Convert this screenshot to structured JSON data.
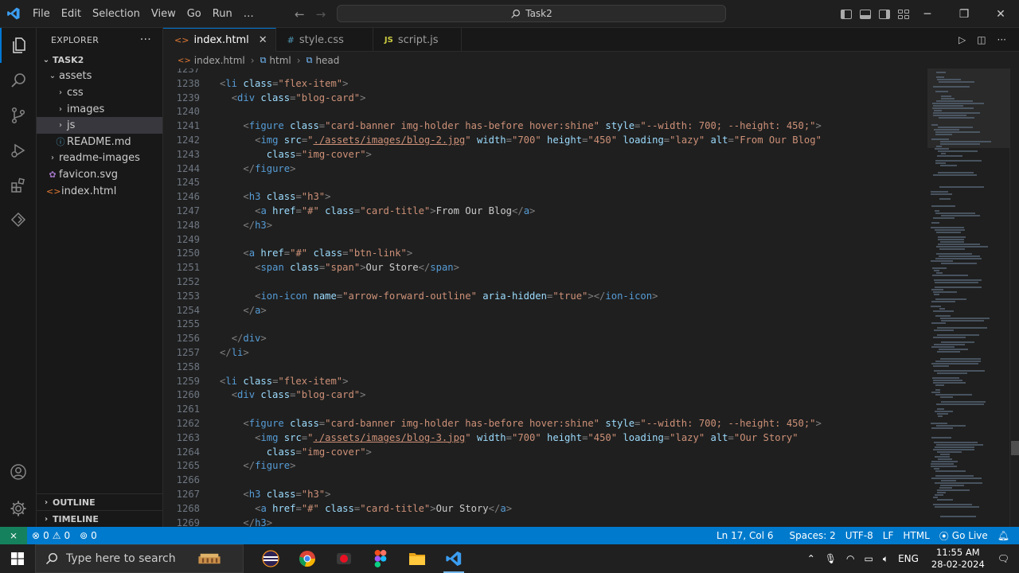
{
  "titlebar": {
    "menu": [
      "File",
      "Edit",
      "Selection",
      "View",
      "Go",
      "Run",
      "…"
    ],
    "search_text": "Task2"
  },
  "tabs": [
    {
      "label": "index.html",
      "type": "html",
      "active": true
    },
    {
      "label": "style.css",
      "type": "css",
      "active": false
    },
    {
      "label": "script.js",
      "type": "js",
      "active": false
    }
  ],
  "sidebar": {
    "title": "EXPLORER",
    "more": "···",
    "root": "TASK2",
    "items": [
      {
        "label": "assets",
        "depth": 1,
        "kind": "folder-open"
      },
      {
        "label": "css",
        "depth": 2,
        "kind": "folder"
      },
      {
        "label": "images",
        "depth": 2,
        "kind": "folder"
      },
      {
        "label": "js",
        "depth": 2,
        "kind": "folder"
      },
      {
        "label": "README.md",
        "depth": 1,
        "kind": "md"
      },
      {
        "label": "readme-images",
        "depth": 1,
        "kind": "folder"
      },
      {
        "label": "favicon.svg",
        "depth": 0,
        "kind": "svg"
      },
      {
        "label": "index.html",
        "depth": 0,
        "kind": "html"
      }
    ],
    "outline": "OUTLINE",
    "timeline": "TIMELINE"
  },
  "breadcrumb": [
    "index.html",
    "html",
    "head"
  ],
  "code": [
    {
      "n": "1237",
      "i": 12,
      "t": []
    },
    {
      "n": "1238",
      "i": 12,
      "t": [
        [
          "b",
          "<"
        ],
        [
          "g",
          "li"
        ],
        [
          "a",
          " class"
        ],
        [
          "b",
          "="
        ],
        [
          "s",
          "\"flex-item\""
        ],
        [
          "b",
          ">"
        ]
      ]
    },
    {
      "n": "1239",
      "i": 14,
      "t": [
        [
          "b",
          "<"
        ],
        [
          "g",
          "div"
        ],
        [
          "a",
          " class"
        ],
        [
          "b",
          "="
        ],
        [
          "s",
          "\"blog-card\""
        ],
        [
          "b",
          ">"
        ]
      ]
    },
    {
      "n": "1240",
      "i": 0,
      "t": []
    },
    {
      "n": "1241",
      "i": 16,
      "t": [
        [
          "b",
          "<"
        ],
        [
          "g",
          "figure"
        ],
        [
          "a",
          " class"
        ],
        [
          "b",
          "="
        ],
        [
          "s",
          "\"card-banner img-holder has-before hover:shine\""
        ],
        [
          "a",
          " style"
        ],
        [
          "b",
          "="
        ],
        [
          "s",
          "\"--width: 700; --height: 450;\""
        ],
        [
          "b",
          ">"
        ]
      ]
    },
    {
      "n": "1242",
      "i": 18,
      "t": [
        [
          "b",
          "<"
        ],
        [
          "g",
          "img"
        ],
        [
          "a",
          " src"
        ],
        [
          "b",
          "="
        ],
        [
          "s",
          "\""
        ],
        [
          "u",
          "./assets/images/blog-2.jpg"
        ],
        [
          "s",
          "\""
        ],
        [
          "a",
          " width"
        ],
        [
          "b",
          "="
        ],
        [
          "s",
          "\"700\""
        ],
        [
          "a",
          " height"
        ],
        [
          "b",
          "="
        ],
        [
          "s",
          "\"450\""
        ],
        [
          "a",
          " loading"
        ],
        [
          "b",
          "="
        ],
        [
          "s",
          "\"lazy\""
        ],
        [
          "a",
          " alt"
        ],
        [
          "b",
          "="
        ],
        [
          "s",
          "\"From Our Blog\""
        ]
      ]
    },
    {
      "n": "1243",
      "i": 20,
      "t": [
        [
          "a",
          "class"
        ],
        [
          "b",
          "="
        ],
        [
          "s",
          "\"img-cover\""
        ],
        [
          "b",
          ">"
        ]
      ]
    },
    {
      "n": "1244",
      "i": 16,
      "t": [
        [
          "b",
          "</"
        ],
        [
          "g",
          "figure"
        ],
        [
          "b",
          ">"
        ]
      ]
    },
    {
      "n": "1245",
      "i": 0,
      "t": []
    },
    {
      "n": "1246",
      "i": 16,
      "t": [
        [
          "b",
          "<"
        ],
        [
          "g",
          "h3"
        ],
        [
          "a",
          " class"
        ],
        [
          "b",
          "="
        ],
        [
          "s",
          "\"h3\""
        ],
        [
          "b",
          ">"
        ]
      ]
    },
    {
      "n": "1247",
      "i": 18,
      "t": [
        [
          "b",
          "<"
        ],
        [
          "g",
          "a"
        ],
        [
          "a",
          " href"
        ],
        [
          "b",
          "="
        ],
        [
          "s",
          "\"#\""
        ],
        [
          "a",
          " class"
        ],
        [
          "b",
          "="
        ],
        [
          "s",
          "\"card-title\""
        ],
        [
          "b",
          ">"
        ],
        [
          "x",
          "From Our Blog"
        ],
        [
          "b",
          "</"
        ],
        [
          "g",
          "a"
        ],
        [
          "b",
          ">"
        ]
      ]
    },
    {
      "n": "1248",
      "i": 16,
      "t": [
        [
          "b",
          "</"
        ],
        [
          "g",
          "h3"
        ],
        [
          "b",
          ">"
        ]
      ]
    },
    {
      "n": "1249",
      "i": 0,
      "t": []
    },
    {
      "n": "1250",
      "i": 16,
      "t": [
        [
          "b",
          "<"
        ],
        [
          "g",
          "a"
        ],
        [
          "a",
          " href"
        ],
        [
          "b",
          "="
        ],
        [
          "s",
          "\"#\""
        ],
        [
          "a",
          " class"
        ],
        [
          "b",
          "="
        ],
        [
          "s",
          "\"btn-link\""
        ],
        [
          "b",
          ">"
        ]
      ]
    },
    {
      "n": "1251",
      "i": 18,
      "t": [
        [
          "b",
          "<"
        ],
        [
          "g",
          "span"
        ],
        [
          "a",
          " class"
        ],
        [
          "b",
          "="
        ],
        [
          "s",
          "\"span\""
        ],
        [
          "b",
          ">"
        ],
        [
          "x",
          "Our Store"
        ],
        [
          "b",
          "</"
        ],
        [
          "g",
          "span"
        ],
        [
          "b",
          ">"
        ]
      ]
    },
    {
      "n": "1252",
      "i": 0,
      "t": []
    },
    {
      "n": "1253",
      "i": 18,
      "t": [
        [
          "b",
          "<"
        ],
        [
          "g",
          "ion-icon"
        ],
        [
          "a",
          " name"
        ],
        [
          "b",
          "="
        ],
        [
          "s",
          "\"arrow-forward-outline\""
        ],
        [
          "a",
          " aria-hidden"
        ],
        [
          "b",
          "="
        ],
        [
          "s",
          "\"true\""
        ],
        [
          "b",
          "></"
        ],
        [
          "g",
          "ion-icon"
        ],
        [
          "b",
          ">"
        ]
      ]
    },
    {
      "n": "1254",
      "i": 16,
      "t": [
        [
          "b",
          "</"
        ],
        [
          "g",
          "a"
        ],
        [
          "b",
          ">"
        ]
      ]
    },
    {
      "n": "1255",
      "i": 0,
      "t": []
    },
    {
      "n": "1256",
      "i": 14,
      "t": [
        [
          "b",
          "</"
        ],
        [
          "g",
          "div"
        ],
        [
          "b",
          ">"
        ]
      ]
    },
    {
      "n": "1257",
      "i": 12,
      "t": [
        [
          "b",
          "</"
        ],
        [
          "g",
          "li"
        ],
        [
          "b",
          ">"
        ]
      ]
    },
    {
      "n": "1258",
      "i": 0,
      "t": []
    },
    {
      "n": "1259",
      "i": 12,
      "t": [
        [
          "b",
          "<"
        ],
        [
          "g",
          "li"
        ],
        [
          "a",
          " class"
        ],
        [
          "b",
          "="
        ],
        [
          "s",
          "\"flex-item\""
        ],
        [
          "b",
          ">"
        ]
      ]
    },
    {
      "n": "1260",
      "i": 14,
      "t": [
        [
          "b",
          "<"
        ],
        [
          "g",
          "div"
        ],
        [
          "a",
          " class"
        ],
        [
          "b",
          "="
        ],
        [
          "s",
          "\"blog-card\""
        ],
        [
          "b",
          ">"
        ]
      ]
    },
    {
      "n": "1261",
      "i": 0,
      "t": []
    },
    {
      "n": "1262",
      "i": 16,
      "t": [
        [
          "b",
          "<"
        ],
        [
          "g",
          "figure"
        ],
        [
          "a",
          " class"
        ],
        [
          "b",
          "="
        ],
        [
          "s",
          "\"card-banner img-holder has-before hover:shine\""
        ],
        [
          "a",
          " style"
        ],
        [
          "b",
          "="
        ],
        [
          "s",
          "\"--width: 700; --height: 450;\""
        ],
        [
          "b",
          ">"
        ]
      ]
    },
    {
      "n": "1263",
      "i": 18,
      "t": [
        [
          "b",
          "<"
        ],
        [
          "g",
          "img"
        ],
        [
          "a",
          " src"
        ],
        [
          "b",
          "="
        ],
        [
          "s",
          "\""
        ],
        [
          "u",
          "./assets/images/blog-3.jpg"
        ],
        [
          "s",
          "\""
        ],
        [
          "a",
          " width"
        ],
        [
          "b",
          "="
        ],
        [
          "s",
          "\"700\""
        ],
        [
          "a",
          " height"
        ],
        [
          "b",
          "="
        ],
        [
          "s",
          "\"450\""
        ],
        [
          "a",
          " loading"
        ],
        [
          "b",
          "="
        ],
        [
          "s",
          "\"lazy\""
        ],
        [
          "a",
          " alt"
        ],
        [
          "b",
          "="
        ],
        [
          "s",
          "\"Our Story\""
        ]
      ]
    },
    {
      "n": "1264",
      "i": 20,
      "t": [
        [
          "a",
          "class"
        ],
        [
          "b",
          "="
        ],
        [
          "s",
          "\"img-cover\""
        ],
        [
          "b",
          ">"
        ]
      ]
    },
    {
      "n": "1265",
      "i": 16,
      "t": [
        [
          "b",
          "</"
        ],
        [
          "g",
          "figure"
        ],
        [
          "b",
          ">"
        ]
      ]
    },
    {
      "n": "1266",
      "i": 0,
      "t": []
    },
    {
      "n": "1267",
      "i": 16,
      "t": [
        [
          "b",
          "<"
        ],
        [
          "g",
          "h3"
        ],
        [
          "a",
          " class"
        ],
        [
          "b",
          "="
        ],
        [
          "s",
          "\"h3\""
        ],
        [
          "b",
          ">"
        ]
      ]
    },
    {
      "n": "1268",
      "i": 18,
      "t": [
        [
          "b",
          "<"
        ],
        [
          "g",
          "a"
        ],
        [
          "a",
          " href"
        ],
        [
          "b",
          "="
        ],
        [
          "s",
          "\"#\""
        ],
        [
          "a",
          " class"
        ],
        [
          "b",
          "="
        ],
        [
          "s",
          "\"card-title\""
        ],
        [
          "b",
          ">"
        ],
        [
          "x",
          "Our Story"
        ],
        [
          "b",
          "</"
        ],
        [
          "g",
          "a"
        ],
        [
          "b",
          ">"
        ]
      ]
    },
    {
      "n": "1269",
      "i": 16,
      "t": [
        [
          "b",
          "</"
        ],
        [
          "g",
          "h3"
        ],
        [
          "b",
          ">"
        ]
      ]
    }
  ],
  "status": {
    "errors": "0",
    "warnings": "0",
    "ports": "0",
    "position": "Ln 17, Col 6",
    "spaces": "Spaces: 2",
    "encoding": "UTF-8",
    "eol": "LF",
    "language": "HTML",
    "golive": "Go Live"
  },
  "taskbar": {
    "search_placeholder": "Type here to search",
    "lang": "ENG",
    "time": "11:55 AM",
    "date": "28-02-2024"
  },
  "colors": {
    "accent": "#0078d4",
    "statusbar": "#007acc",
    "remote": "#16825d"
  }
}
